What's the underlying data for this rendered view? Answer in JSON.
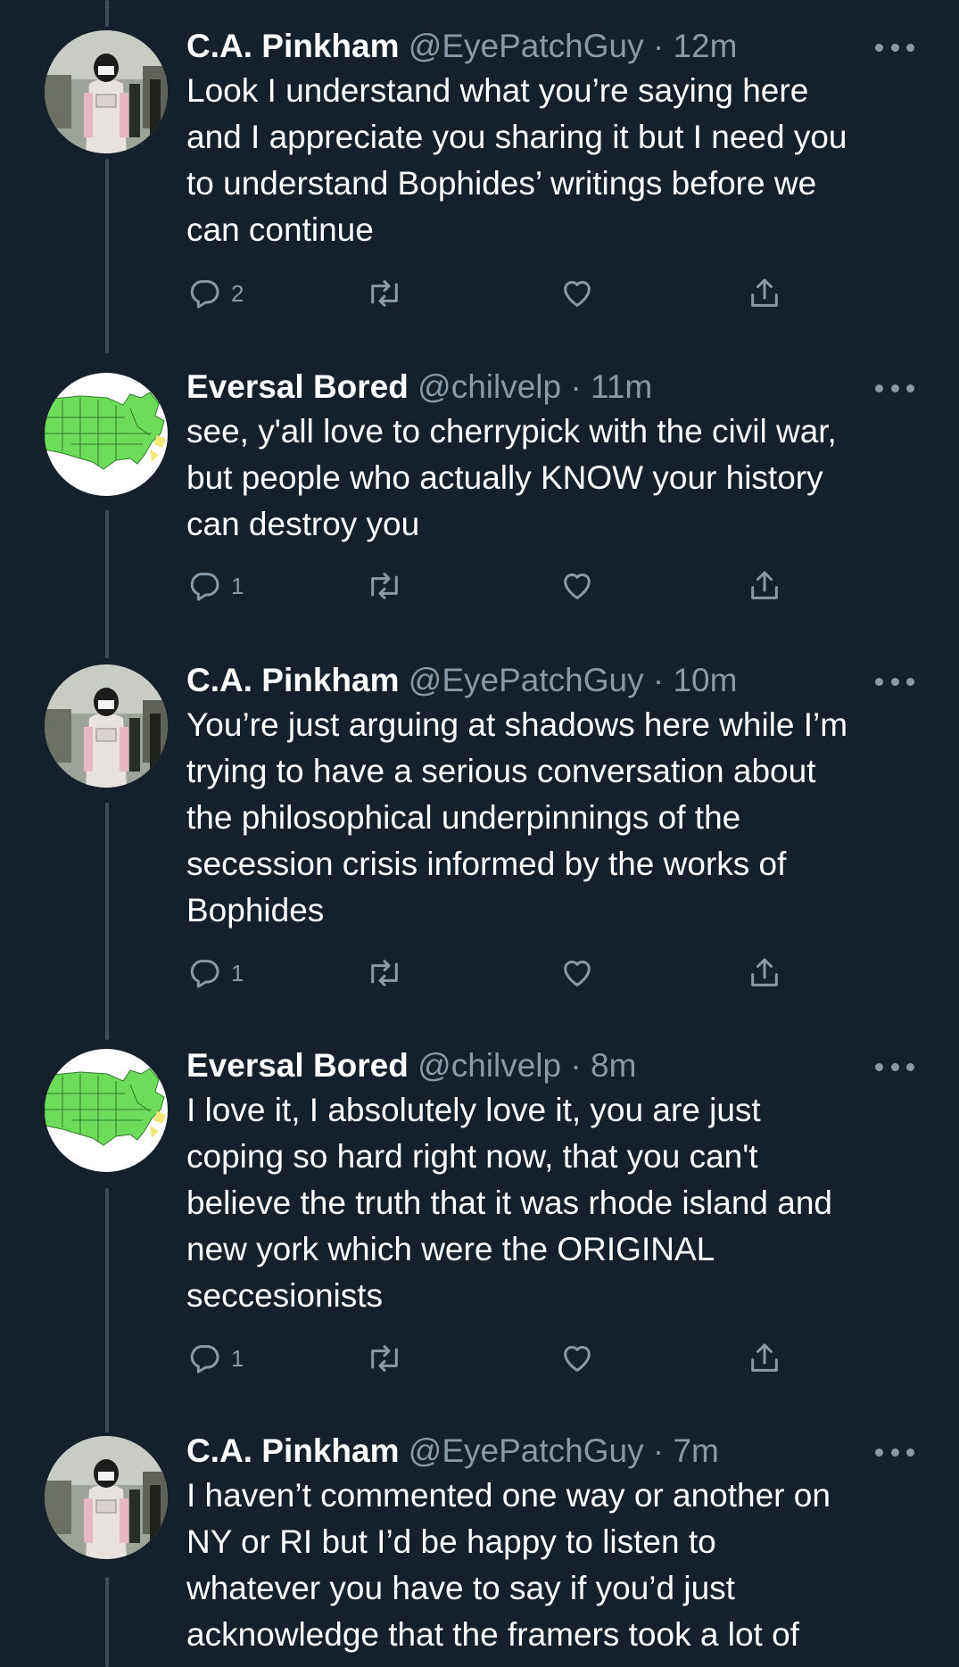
{
  "tweets": [
    {
      "name": "C.A. Pinkham",
      "handle": "@EyePatchGuy",
      "time": "12m",
      "avatar": "vader-costume-avatar",
      "text": "Look I understand what you’re saying here\nand I appreciate you sharing it but I need you\nto understand Bophides’ writings before we\ncan continue",
      "reply_count": "2"
    },
    {
      "name": "Eversal Bored",
      "handle": "@chilvelp",
      "time": "11m",
      "avatar": "green-us-map-avatar",
      "text": "see, y'all love to cherrypick with the civil war,\nbut people who actually KNOW your history\ncan destroy you",
      "reply_count": "1"
    },
    {
      "name": "C.A. Pinkham",
      "handle": "@EyePatchGuy",
      "time": "10m",
      "avatar": "vader-costume-avatar",
      "text": "You’re just arguing at shadows here while I’m\ntrying to have a serious conversation about\nthe philosophical underpinnings of the\nsecession crisis informed by the works of\nBophides",
      "reply_count": "1"
    },
    {
      "name": "Eversal Bored",
      "handle": "@chilvelp",
      "time": "8m",
      "avatar": "green-us-map-avatar",
      "text": "I love it, I absolutely love it, you are just\ncoping so hard right now, that you can't\nbelieve the truth that it was rhode island and\nnew york which were the ORIGINAL\nseccesionists",
      "reply_count": "1"
    },
    {
      "name": "C.A. Pinkham",
      "handle": "@EyePatchGuy",
      "time": "7m",
      "avatar": "vader-costume-avatar",
      "text": "I haven’t commented one way or another on\nNY or RI but I’d be happy to listen to\nwhatever you have to say if you’d just\nacknowledge that the framers took a lot of",
      "reply_count": ""
    }
  ],
  "separator": "·",
  "icons": {
    "reply": "reply-icon",
    "retweet": "retweet-icon",
    "like": "heart-icon",
    "share": "share-icon",
    "more": "more-icon"
  },
  "colors": {
    "background": "#15202b",
    "secondary_text": "#8b98a5",
    "thread_line": "#3d4d5c"
  }
}
